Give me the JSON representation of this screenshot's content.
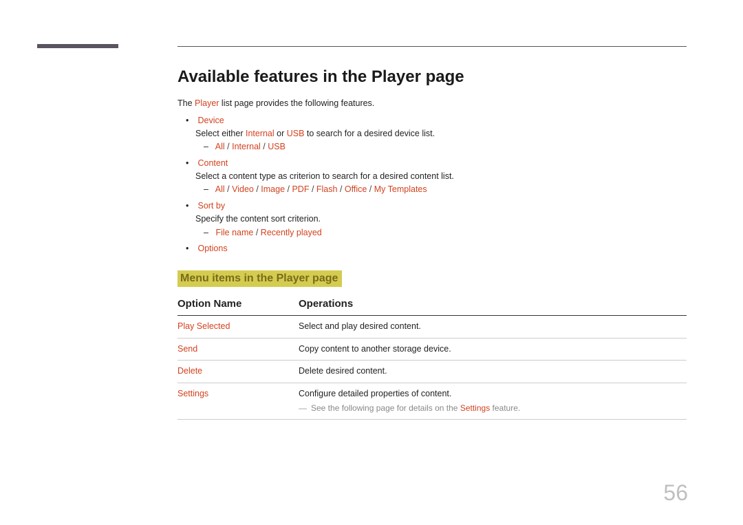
{
  "page_number": "56",
  "title": "Available features in the Player page",
  "intro_pre": "The ",
  "intro_keyword": "Player",
  "intro_post": " list page provides the following features.",
  "features": {
    "device": {
      "label": "Device",
      "desc_pre": "Select either ",
      "k1": "Internal",
      "desc_mid": " or ",
      "k2": "USB",
      "desc_post": " to search for a desired device list.",
      "opts": {
        "all": "All",
        "internal": "Internal",
        "usb": "USB"
      }
    },
    "content": {
      "label": "Content",
      "desc": "Select a content type as criterion to search for a desired content list.",
      "opts": {
        "all": "All",
        "video": "Video",
        "image": "Image",
        "pdf": "PDF",
        "flash": "Flash",
        "office": "Office",
        "my_templates": "My Templates"
      }
    },
    "sortby": {
      "label": "Sort by",
      "desc": "Specify the content sort criterion.",
      "opts": {
        "file_name": "File name",
        "recently_played": "Recently played"
      }
    },
    "options": {
      "label": "Options"
    }
  },
  "subtitle": "Menu items in the Player page",
  "table": {
    "head": {
      "col1": "Option Name",
      "col2": "Operations"
    },
    "rows": [
      {
        "name": "Play Selected",
        "op": "Select and play desired content."
      },
      {
        "name": "Send",
        "op": "Copy content to another storage device."
      },
      {
        "name": "Delete",
        "op": "Delete desired content."
      },
      {
        "name": "Settings",
        "op": "Configure detailed properties of content.",
        "note_pre": "See the following page for details on the ",
        "note_kw": "Settings",
        "note_post": " feature."
      }
    ]
  },
  "slash": " / "
}
